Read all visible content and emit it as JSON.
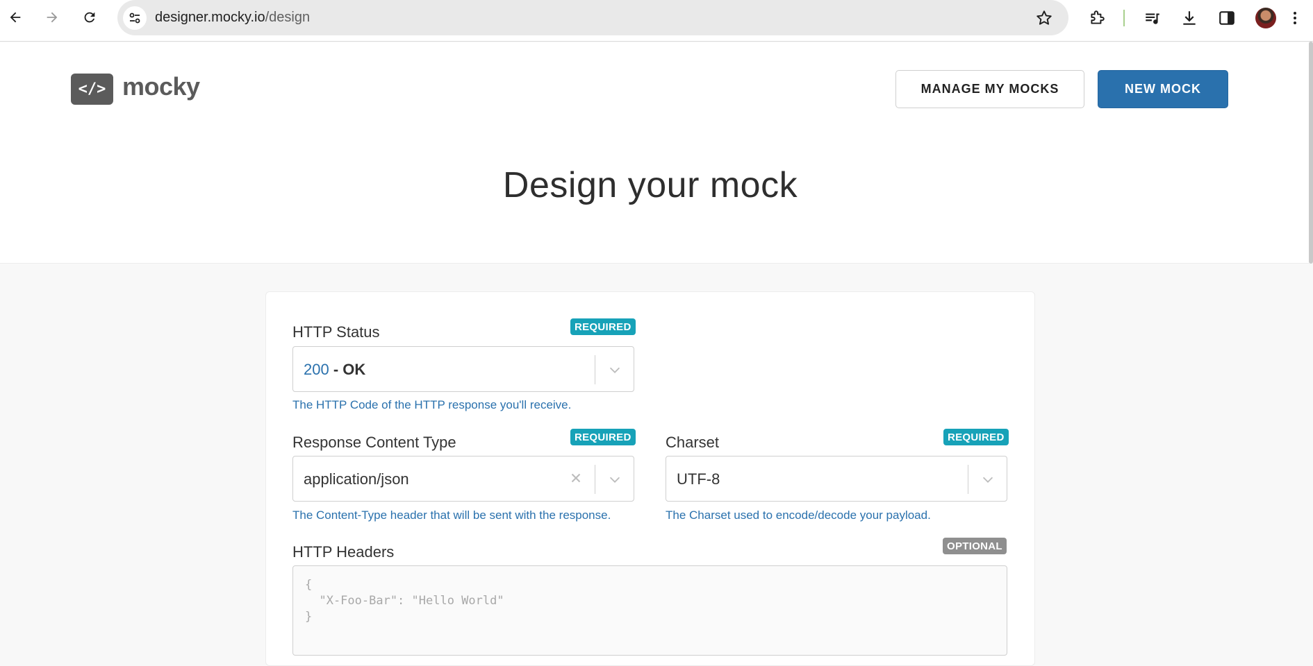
{
  "browser": {
    "url_host": "designer.mocky.io",
    "url_path": "/design"
  },
  "header": {
    "logo_mark": "</>",
    "logo_text": "mocky",
    "manage_label": "MANAGE MY MOCKS",
    "new_label": "NEW MOCK"
  },
  "hero": {
    "title": "Design your mock"
  },
  "form": {
    "http_status": {
      "label": "HTTP Status",
      "badge": "REQUIRED",
      "code": "200",
      "separator": " - OK",
      "help": "The HTTP Code of the HTTP response you'll receive."
    },
    "content_type": {
      "label": "Response Content Type",
      "badge": "REQUIRED",
      "value": "application/json",
      "help": "The Content-Type header that will be sent with the response."
    },
    "charset": {
      "label": "Charset",
      "badge": "REQUIRED",
      "value": "UTF-8",
      "help": "The Charset used to encode/decode your payload."
    },
    "headers": {
      "label": "HTTP Headers",
      "badge": "OPTIONAL",
      "placeholder": "{\n  \"X-Foo-Bar\": \"Hello World\"\n}"
    }
  },
  "colors": {
    "brand_blue": "#2a71ad",
    "required_badge": "#17a2b8",
    "optional_badge": "#8f8f8f",
    "logo_gray": "#5b5b5b"
  }
}
